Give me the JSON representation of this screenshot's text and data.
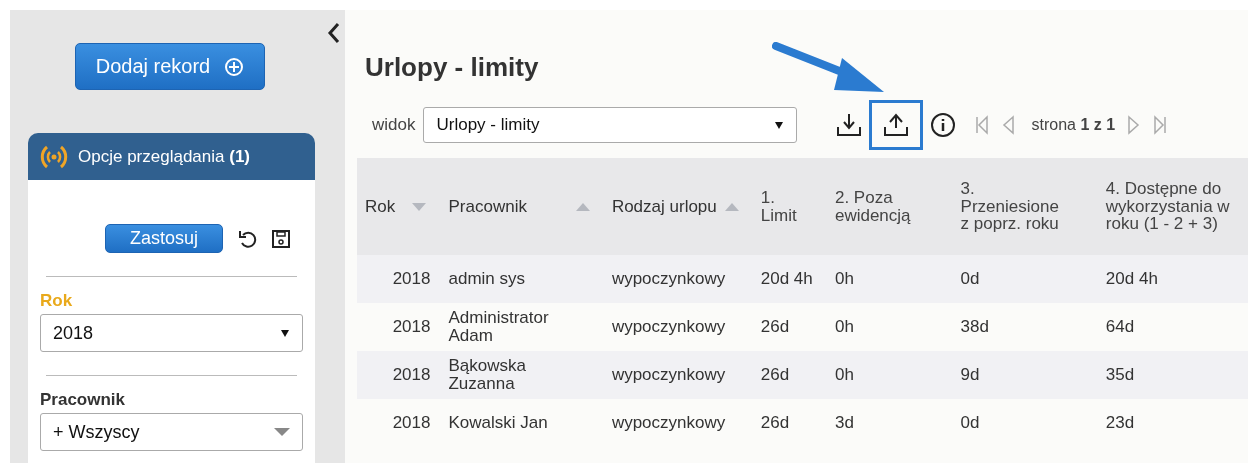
{
  "sidebar": {
    "add_button": "Dodaj rekord",
    "options_panel": {
      "title": "Opcje przeglądania **(1)**",
      "apply_button": "Zastosuj",
      "filters": [
        {
          "label": "Rok",
          "value": "2018",
          "active": true,
          "kind": "select"
        },
        {
          "label": "Pracownik",
          "value": "+ Wszyscy",
          "active": false,
          "kind": "combo"
        }
      ]
    }
  },
  "page": {
    "title": "Urlopy - limity",
    "view_label": "widok",
    "view_value": "Urlopy - limity",
    "toolbar": [
      {
        "kind": "download",
        "highlighted": false
      },
      {
        "kind": "upload",
        "highlighted": true
      },
      {
        "kind": "info",
        "highlighted": false
      }
    ],
    "pager": "strona **1 z 1**"
  },
  "table": {
    "columns": [
      {
        "label": "Rok",
        "sorted": true,
        "descending": true
      },
      {
        "label": "Pracownik",
        "sorted": true,
        "descending": false
      },
      {
        "label": "Rodzaj urlopu",
        "sorted": true,
        "descending": false
      },
      {
        "label": "1.\nLimit",
        "sorted": false
      },
      {
        "label": "2. Poza\newidencją",
        "sorted": false
      },
      {
        "label": "3.\nPrzeniesione\nz poprz. roku",
        "sorted": false
      },
      {
        "label": "4. Dostępne do\nwykorzystania w\nroku (1 - 2 + 3)",
        "sorted": false
      }
    ],
    "rows": [
      [
        "2018",
        "admin sys",
        "wypoczynkowy",
        "20d 4h",
        "0h",
        "0d",
        "20d 4h"
      ],
      [
        "2018",
        "Administrator\nAdam",
        "wypoczynkowy",
        "26d",
        "0h",
        "38d",
        "64d"
      ],
      [
        "2018",
        "Bąkowska\nZuzanna",
        "wypoczynkowy",
        "26d",
        "0h",
        "9d",
        "35d"
      ],
      [
        "2018",
        "Kowalski Jan",
        "wypoczynkowy",
        "26d",
        "3d",
        "0d",
        "23d"
      ]
    ]
  }
}
